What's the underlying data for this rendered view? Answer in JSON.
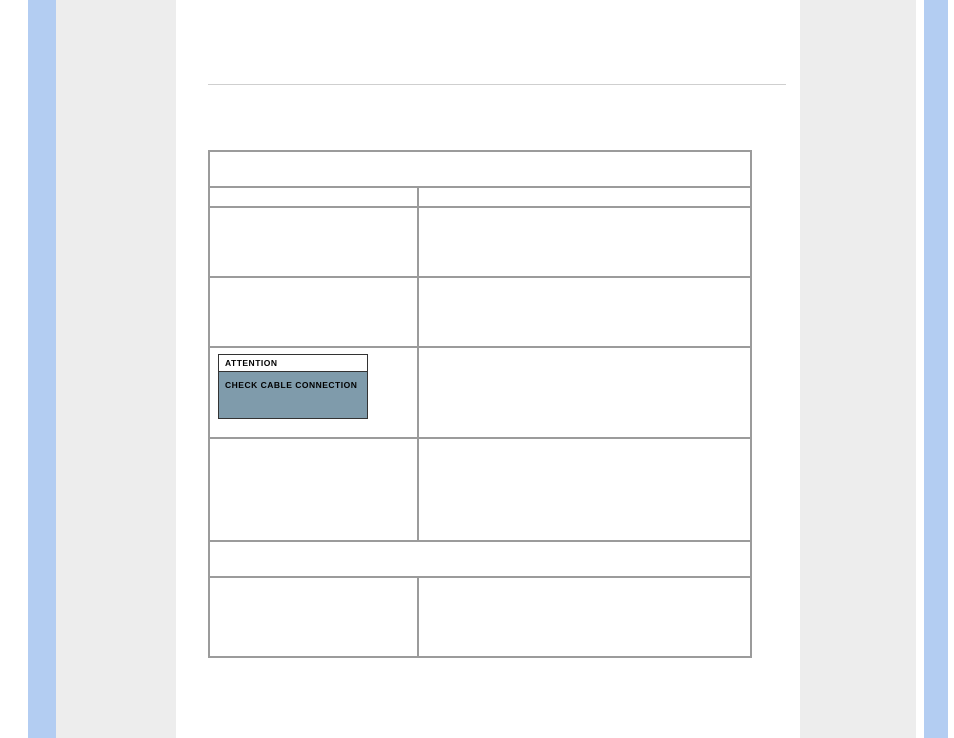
{
  "module": {
    "header": "ATTENTION",
    "body": "CHECK CABLE CONNECTION"
  }
}
